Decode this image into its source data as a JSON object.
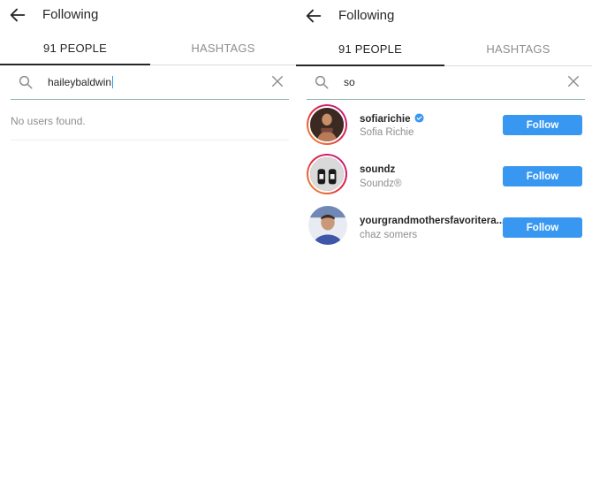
{
  "left": {
    "header": {
      "title": "Following"
    },
    "tabs": [
      {
        "label": "91 PEOPLE"
      },
      {
        "label": "HASHTAGS"
      }
    ],
    "search": {
      "value": "haileybaldwin"
    },
    "empty_message": "No users found."
  },
  "right": {
    "header": {
      "title": "Following"
    },
    "tabs": [
      {
        "label": "91 PEOPLE"
      },
      {
        "label": "HASHTAGS"
      }
    ],
    "search": {
      "value": "so"
    },
    "results": [
      {
        "username": "sofiarichie",
        "fullname": "Sofia Richie",
        "verified": true,
        "button": "Follow"
      },
      {
        "username": "soundz",
        "fullname": "Soundz®",
        "verified": false,
        "button": "Follow"
      },
      {
        "username": "yourgrandmothersfavoritera...",
        "fullname": "chaz somers",
        "verified": false,
        "button": "Follow"
      }
    ]
  },
  "colors": {
    "accent": "#3897f0",
    "text": "#262626",
    "muted": "#8e8e8e",
    "divider": "#dbdbdb"
  }
}
